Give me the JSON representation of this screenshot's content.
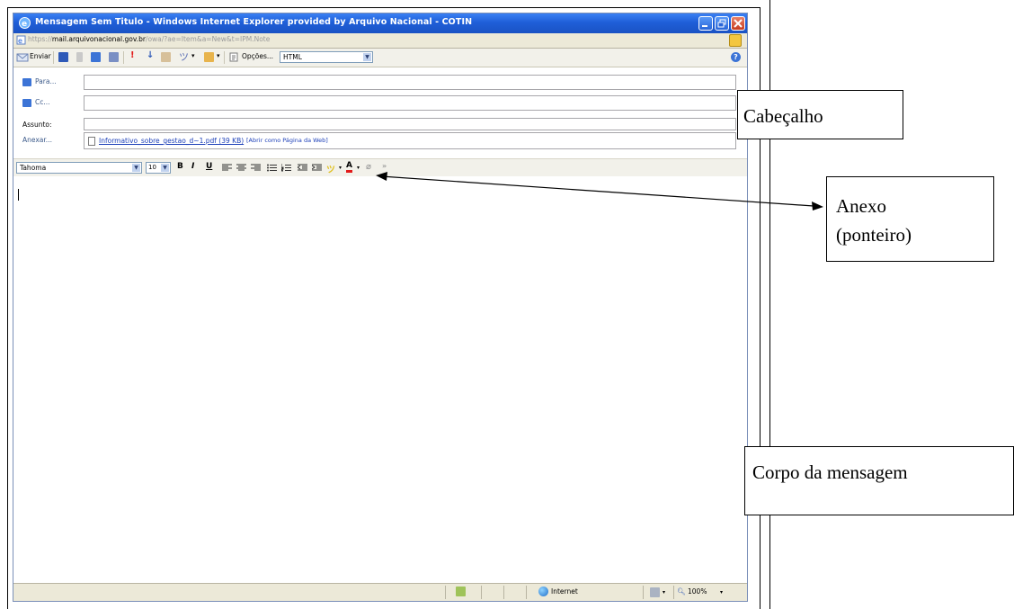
{
  "window": {
    "title": "Mensagem Sem Titulo - Windows Internet Explorer provided by Arquivo Nacional - COTIN",
    "address_host_prefix": "https://",
    "address_host": "mail.arquivonacional.gov.br",
    "address_path": "/owa/?ae=Item&a=New&t=IPM.Note"
  },
  "toolbar": {
    "send_label": "Enviar",
    "options_label": "Opções...",
    "format_value": "HTML"
  },
  "header": {
    "to_label": "Para...",
    "cc_label": "Cc...",
    "subject_label": "Assunto:",
    "attach_label": "Anexar...",
    "attachment_name": "Informativo_sobre_gestao_d~1.pdf (39 KB)",
    "attachment_open_web": "[Abrir como Página da Web]"
  },
  "editor_toolbar": {
    "font_name": "Tahoma",
    "font_size": "10",
    "bold": "B",
    "italic": "I",
    "underline": "U",
    "font_color": "A"
  },
  "statusbar": {
    "zone": "Internet",
    "zoom": "100%"
  },
  "callouts": {
    "header": "Cabeçalho",
    "attachment_line1": "Anexo",
    "attachment_line2": "(ponteiro)",
    "body": "Corpo da mensagem"
  },
  "colors": {
    "titlebar": "#1f5fd8",
    "link": "#1c3fb8",
    "chrome": "#ece9d8"
  }
}
